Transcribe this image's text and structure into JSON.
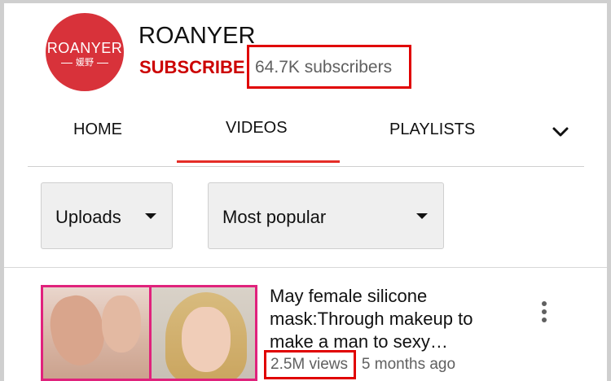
{
  "channel": {
    "logo_wordmark": "ROANYER",
    "logo_subtext": "媛野",
    "name": "ROANYER",
    "subscribe_label": "SUBSCRIBE",
    "subscriber_count": "64.7K subscribers"
  },
  "tabs": [
    {
      "label": "HOME",
      "active": false
    },
    {
      "label": "VIDEOS",
      "active": true
    },
    {
      "label": "PLAYLISTS",
      "active": false
    }
  ],
  "tabs_more_icon": "chevron-down-icon",
  "filters": {
    "uploads_label": "Uploads",
    "sort_label": "Most popular"
  },
  "video": {
    "title": "May female silicone mask:Through makeup to make a man to sexy…",
    "views": "2.5M views",
    "separator": "·",
    "age": "5 months ago",
    "menu_icon": "more-vert-icon"
  },
  "colors": {
    "accent_red": "#cc0000",
    "tab_underline": "#e52d27",
    "highlight_box": "#e00000",
    "logo_bg": "#d8323a",
    "thumbnail_border": "#e0227c"
  }
}
